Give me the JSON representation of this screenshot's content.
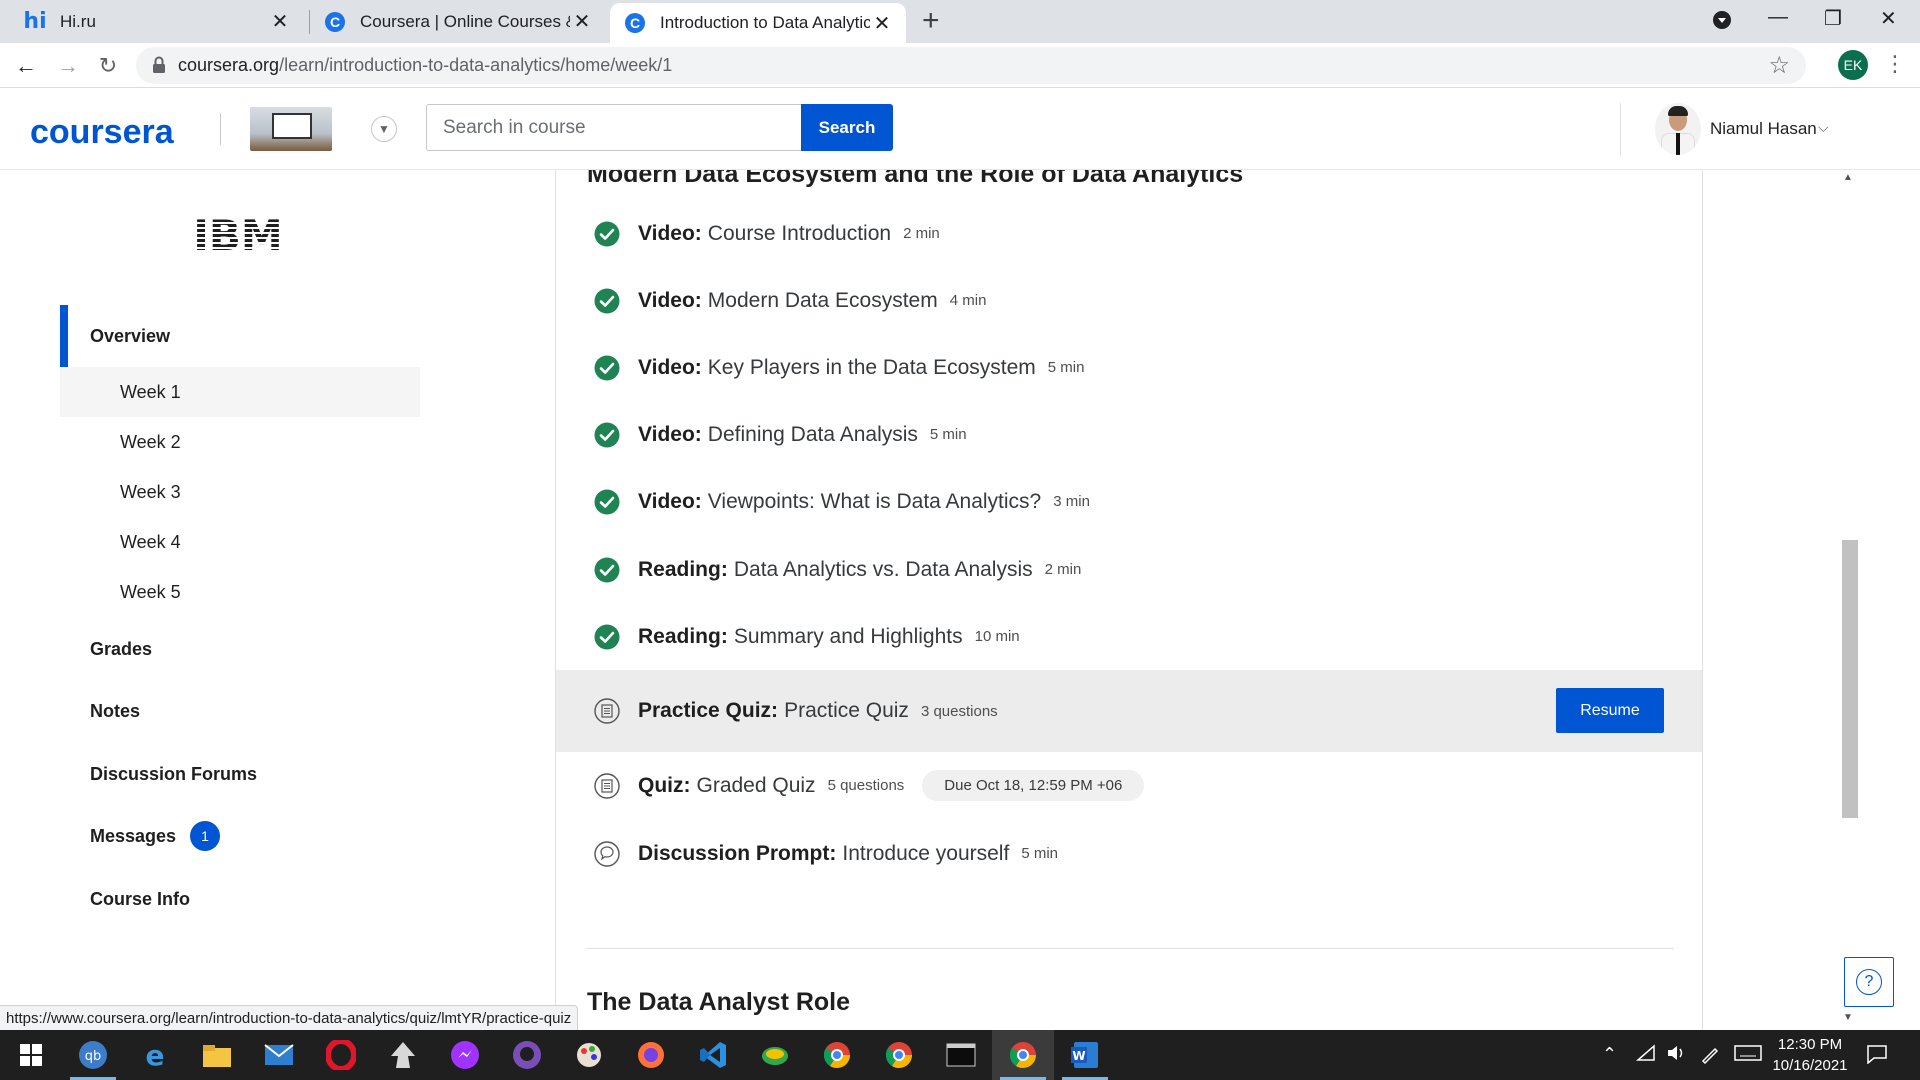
{
  "browser": {
    "tabs": [
      {
        "title": "Hi.ru",
        "favicon": "hi-favicon"
      },
      {
        "title": "Coursera | Online Courses & Crec",
        "favicon": "coursera-favicon"
      },
      {
        "title": "Introduction to Data Analytics - \\",
        "favicon": "coursera-favicon",
        "active": true
      }
    ],
    "url_host": "coursera.org",
    "url_path": "/learn/introduction-to-data-analytics/home/week/1",
    "profile_initials": "EK"
  },
  "header": {
    "logo": "coursera",
    "search_placeholder": "Search in course",
    "search_button": "Search",
    "user_name": "Niamul Hasan"
  },
  "sidebar": {
    "partner_logo": "IBM",
    "overview": "Overview",
    "weeks": [
      "Week 1",
      "Week 2",
      "Week 3",
      "Week 4",
      "Week 5"
    ],
    "grades": "Grades",
    "notes": "Notes",
    "forums": "Discussion Forums",
    "messages": "Messages",
    "messages_count": "1",
    "course_info": "Course Info"
  },
  "main": {
    "section_title": "Modern Data Ecosystem and the Role of Data Analytics",
    "items": [
      {
        "type": "Video:",
        "title": "Course Introduction",
        "meta": "2 min",
        "status": "completed"
      },
      {
        "type": "Video:",
        "title": "Modern Data Ecosystem",
        "meta": "4 min",
        "status": "completed"
      },
      {
        "type": "Video:",
        "title": "Key Players in the Data Ecosystem",
        "meta": "5 min",
        "status": "completed"
      },
      {
        "type": "Video:",
        "title": "Defining Data Analysis",
        "meta": "5 min",
        "status": "completed"
      },
      {
        "type": "Video:",
        "title": "Viewpoints: What is Data Analytics?",
        "meta": "3 min",
        "status": "completed"
      },
      {
        "type": "Reading:",
        "title": "Data Analytics vs. Data Analysis",
        "meta": "2 min",
        "status": "completed"
      },
      {
        "type": "Reading:",
        "title": "Summary and Highlights",
        "meta": "10 min",
        "status": "completed"
      },
      {
        "type": "Practice Quiz:",
        "title": "Practice Quiz",
        "meta": "3 questions",
        "status": "in-progress",
        "action": "Resume"
      },
      {
        "type": "Quiz:",
        "title": "Graded Quiz",
        "meta": "5 questions",
        "status": "todo",
        "due": "Due Oct 18, 12:59 PM +06"
      },
      {
        "type": "Discussion Prompt:",
        "title": "Introduce yourself",
        "meta": "5 min",
        "status": "todo"
      }
    ],
    "next_section_title": "The Data Analyst Role"
  },
  "status_url": "https://www.coursera.org/learn/introduction-to-data-analytics/quiz/lmtYR/practice-quiz",
  "taskbar": {
    "time": "12:30 PM",
    "date": "10/16/2021"
  },
  "colors": {
    "brand": "#0056d2",
    "completed": "#1f8354",
    "highlight_row": "#ececec"
  }
}
